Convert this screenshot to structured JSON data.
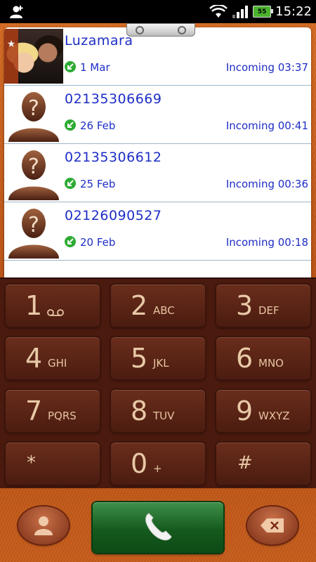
{
  "status_bar": {
    "time": "15:22",
    "battery": "55"
  },
  "call_log": [
    {
      "name": "Luzamara",
      "date": "1 Mar",
      "call_info": "Incoming 03:37",
      "avatar": "contact-photo",
      "starred": true
    },
    {
      "name": "02135306669",
      "date": "26 Feb",
      "call_info": "Incoming 00:41",
      "avatar": "unknown-contact-icon"
    },
    {
      "name": "02135306612",
      "date": "25 Feb",
      "call_info": "Incoming 00:36",
      "avatar": "unknown-contact-icon"
    },
    {
      "name": "02126090527",
      "date": "20 Feb",
      "call_info": "Incoming 00:18",
      "avatar": "unknown-contact-icon"
    }
  ],
  "keypad": [
    {
      "digit": "1",
      "letters": "voicemail-icon"
    },
    {
      "digit": "2",
      "letters": "ABC"
    },
    {
      "digit": "3",
      "letters": "DEF"
    },
    {
      "digit": "4",
      "letters": "GHI"
    },
    {
      "digit": "5",
      "letters": "JKL"
    },
    {
      "digit": "6",
      "letters": "MNO"
    },
    {
      "digit": "7",
      "letters": "PQRS"
    },
    {
      "digit": "8",
      "letters": "TUV"
    },
    {
      "digit": "9",
      "letters": "WXYZ"
    },
    {
      "digit": "*",
      "letters": ""
    },
    {
      "digit": "0",
      "letters": "+"
    },
    {
      "digit": "#",
      "letters": ""
    }
  ],
  "actions": {
    "contacts": "contacts-icon",
    "call": "phone-icon",
    "backspace": "backspace-icon"
  },
  "colors": {
    "accent_blue": "#1d2dc6",
    "incoming_green": "#2dab33",
    "leather_orange": "#c55a18",
    "keypad_brown": "#4a1a0f",
    "call_green": "#145a1d"
  }
}
